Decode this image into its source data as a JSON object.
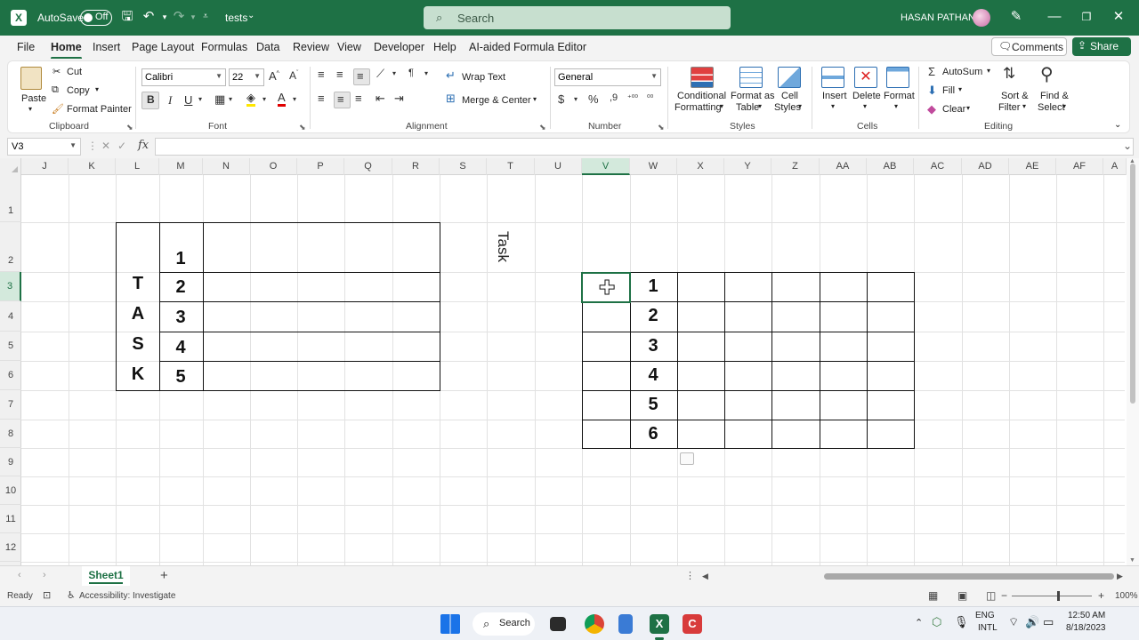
{
  "titlebar": {
    "autosave_label": "AutoSave",
    "autosave_state": "Off",
    "doc_name": "tests",
    "search_placeholder": "Search",
    "user_name": "HASAN PATHAN"
  },
  "menu": {
    "tabs": [
      "File",
      "Home",
      "Insert",
      "Page Layout",
      "Formulas",
      "Data",
      "Review",
      "View",
      "Developer",
      "Help",
      "AI-aided Formula Editor"
    ],
    "active": "Home",
    "comments_label": "Comments",
    "share_label": "Share"
  },
  "ribbon": {
    "clipboard": {
      "paste": "Paste",
      "cut": "Cut",
      "copy": "Copy",
      "format_painter": "Format Painter",
      "label": "Clipboard"
    },
    "font": {
      "name": "Calibri",
      "size": "22",
      "bold": "B",
      "italic": "I",
      "underline": "U",
      "label": "Font"
    },
    "alignment": {
      "wrap_text": "Wrap Text",
      "merge_center": "Merge & Center",
      "label": "Alignment"
    },
    "number": {
      "format": "General",
      "label": "Number"
    },
    "styles": {
      "conditional_1": "Conditional",
      "conditional_2": "Formatting",
      "format_as_1": "Format as",
      "format_as_2": "Table",
      "cell_1": "Cell",
      "cell_2": "Styles",
      "label": "Styles"
    },
    "cells": {
      "insert": "Insert",
      "delete": "Delete",
      "format": "Format",
      "label": "Cells"
    },
    "editing": {
      "autosum": "AutoSum",
      "fill": "Fill",
      "clear": "Clear",
      "sort_1": "Sort &",
      "sort_2": "Filter",
      "find_1": "Find &",
      "find_2": "Select",
      "label": "Editing"
    }
  },
  "formula_bar": {
    "name_box": "V3",
    "fx": "fx",
    "formula": ""
  },
  "grid": {
    "columns": [
      "J",
      "K",
      "L",
      "M",
      "N",
      "O",
      "P",
      "Q",
      "R",
      "S",
      "T",
      "U",
      "V",
      "W",
      "X",
      "Y",
      "Z",
      "AA",
      "AB",
      "AC",
      "AD",
      "AE",
      "AF",
      "A"
    ],
    "rows": [
      "1",
      "2",
      "3",
      "4",
      "5",
      "6",
      "7",
      "8",
      "9",
      "10",
      "11",
      "12"
    ],
    "selected_column": "V",
    "selected_row": "3",
    "left_table": {
      "letters": [
        "T",
        "A",
        "S",
        "K"
      ],
      "numbers": [
        "1",
        "2",
        "3",
        "4",
        "5"
      ]
    },
    "rotated_label": "Task",
    "right_table": {
      "numbers": [
        "1",
        "2",
        "3",
        "4",
        "5",
        "6"
      ]
    }
  },
  "sheets": {
    "tabs": [
      "Sheet1"
    ],
    "active": "Sheet1"
  },
  "status": {
    "ready": "Ready",
    "accessibility": "Accessibility: Investigate",
    "zoom": "100%"
  },
  "taskbar": {
    "search_label": "Search",
    "lang_1": "ENG",
    "lang_2": "INTL",
    "time": "12:50 AM",
    "date": "8/18/2023"
  }
}
